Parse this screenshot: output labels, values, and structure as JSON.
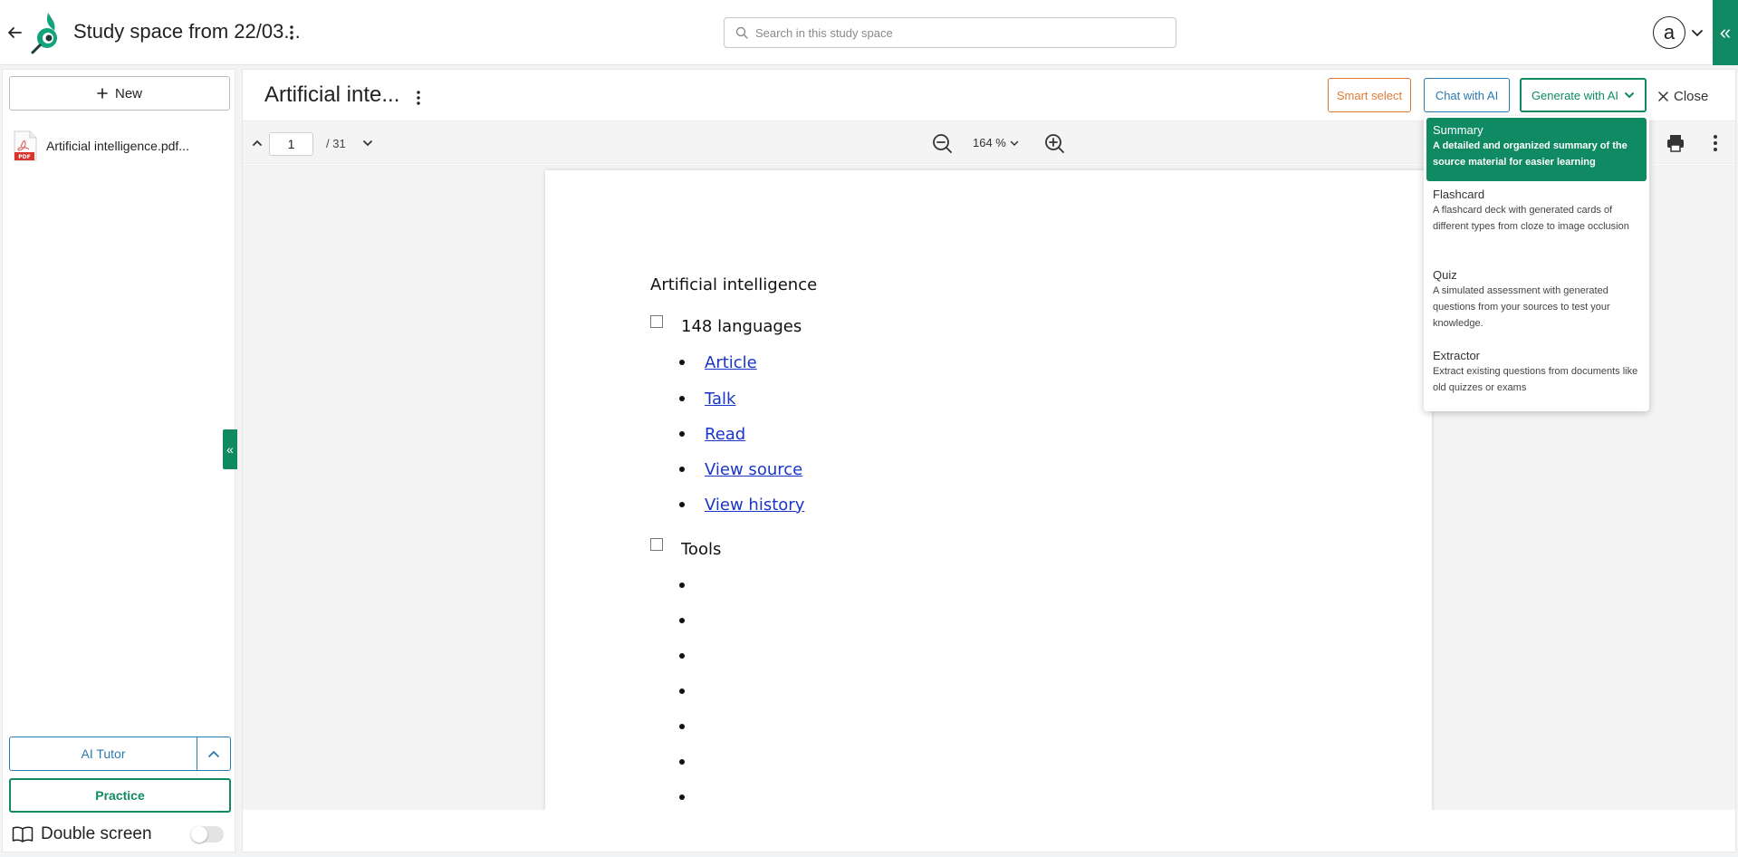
{
  "header": {
    "space_title": "Study space from 22/03...",
    "search_placeholder": "Search in this study space",
    "avatar_letter": "a",
    "collapse_glyph": "«"
  },
  "sidebar": {
    "new_label": "New",
    "files": [
      {
        "name": "Artificial intelligence.pdf...",
        "icon": "pdf-icon"
      }
    ],
    "ai_tutor_label": "AI Tutor",
    "practice_label": "Practice",
    "double_screen_label": "Double screen",
    "double_screen_on": false,
    "collapse_glyph": "«"
  },
  "main": {
    "doc_title": "Artificial inte...",
    "smart_select_label": "Smart select",
    "chat_label": "Chat with AI",
    "generate_label": "Generate with AI",
    "close_label": "Close",
    "toolbar": {
      "current_page": "1",
      "total_pages": "/ 31",
      "zoom": "164 %"
    },
    "document": {
      "heading": "Artificial intelligence",
      "section1_label": "148 languages",
      "links": [
        "Article",
        "Talk",
        "Read",
        "View source",
        "View history"
      ],
      "section2_label": "Tools",
      "empty_bullets": 7
    }
  },
  "generate_menu": {
    "items": [
      {
        "title": "Summary",
        "description": "A detailed and organized summary of the source material for easier learning",
        "active": true
      },
      {
        "title": "Flashcard",
        "description": "A flashcard deck with generated cards of different types from cloze to image occlusion",
        "active": false
      },
      {
        "title": "Quiz",
        "description": "A simulated assessment with generated questions from your sources to test your knowledge.",
        "active": false
      },
      {
        "title": "Extractor",
        "description": "Extract existing questions from documents like old quizzes or exams",
        "active": false
      }
    ]
  },
  "colors": {
    "brand_green": "#0f8a63",
    "blue": "#2a7ab0",
    "orange": "#e07a36",
    "link": "#1a35c9"
  }
}
